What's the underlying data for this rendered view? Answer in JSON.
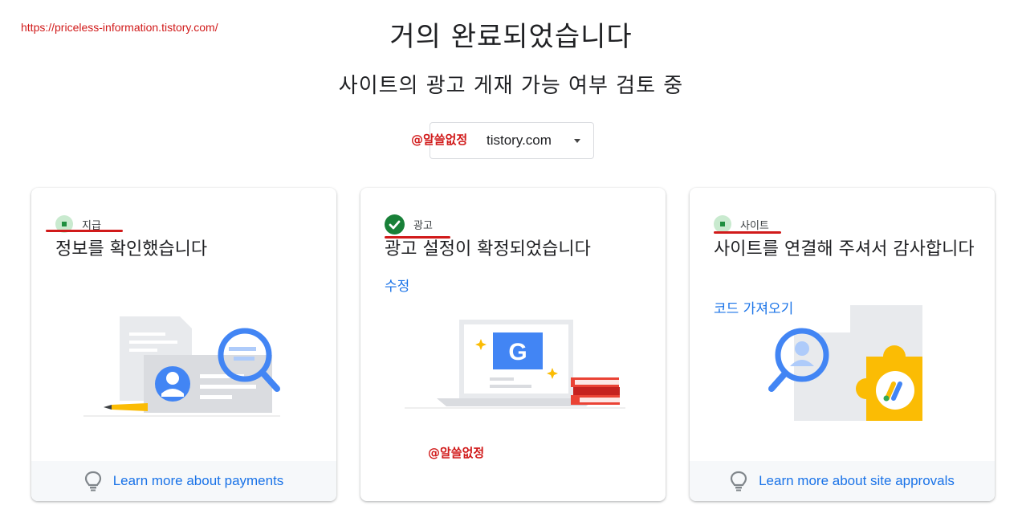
{
  "watermark_url": "https://priceless-information.tistory.com/",
  "header": {
    "title": "거의 완료되었습니다",
    "subtitle": "사이트의 광고 게재 가능 여부 검토 중"
  },
  "site_select": {
    "value": "tistory.com"
  },
  "watermarks": {
    "author": "@알쓸없정"
  },
  "cards": [
    {
      "status_label": "지급",
      "heading": "정보를 확인했습니다",
      "footer_link": "Learn more about payments",
      "icons": [
        "bulb-icon",
        "search-icon",
        "profile-icon",
        "pencil-icon"
      ]
    },
    {
      "status_label": "광고",
      "heading": "광고 설정이 확정되었습니다",
      "link": "수정",
      "icons": [
        "check-icon",
        "google-g-icon",
        "laptop-icon",
        "books-icon"
      ]
    },
    {
      "status_label": "사이트",
      "heading": "사이트를 연결해 주셔서 감사합니다",
      "link": "코드 가져오기",
      "footer_link": "Learn more about site approvals",
      "icons": [
        "bulb-icon",
        "puzzle-icon",
        "search-icon",
        "adsense-icon"
      ]
    }
  ],
  "colors": {
    "accent_blue": "#1a73e8",
    "success_green": "#188038",
    "annotation_red": "#d11a1a"
  }
}
